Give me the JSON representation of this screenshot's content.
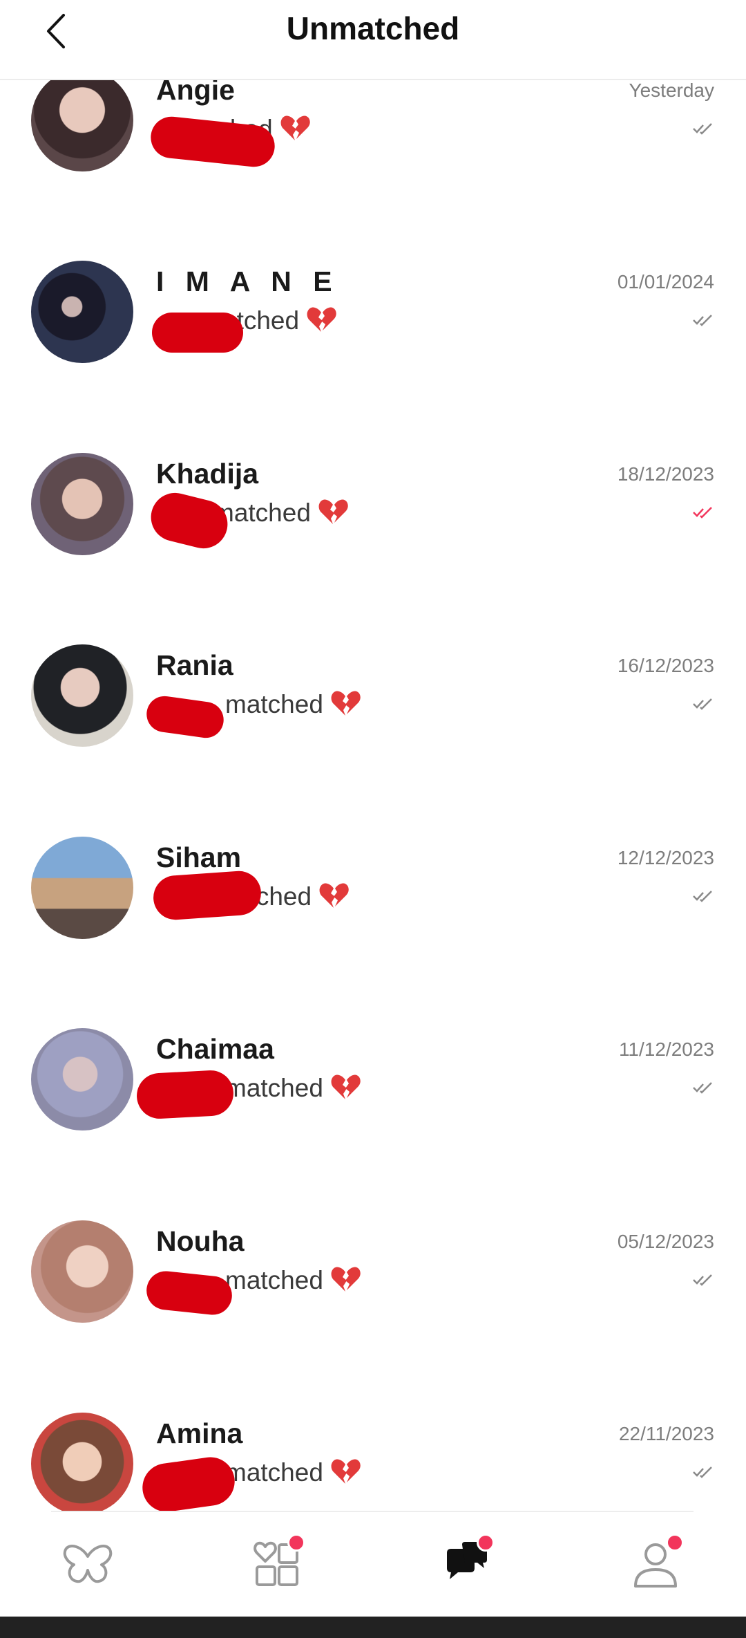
{
  "header": {
    "title": "Unmatched",
    "back_icon": "chevron-left-icon"
  },
  "rows": [
    {
      "name": "Angie",
      "preview": "matched",
      "date": "Yesterday",
      "read": false,
      "avatar_bg": "#4a3a3c"
    },
    {
      "name": "I M A N E",
      "preview": "atched",
      "date": "01/01/2024",
      "read": false,
      "avatar_bg": "#2a2e3e"
    },
    {
      "name": "Khadija",
      "preview": "matched",
      "date": "18/12/2023",
      "read": true,
      "avatar_bg": "#8a6f73"
    },
    {
      "name": "Rania",
      "preview": "matched",
      "date": "16/12/2023",
      "read": false,
      "avatar_bg": "#2b2d33"
    },
    {
      "name": "Siham",
      "preview": "atched",
      "date": "12/12/2023",
      "read": false,
      "avatar_bg": "#7fa4c8"
    },
    {
      "name": "Chaimaa",
      "preview": "matched",
      "date": "11/12/2023",
      "read": false,
      "avatar_bg": "#a2a2b8"
    },
    {
      "name": "Nouha",
      "preview": "matched",
      "date": "05/12/2023",
      "read": false,
      "avatar_bg": "#b6887a"
    },
    {
      "name": "Amina",
      "preview": "matched",
      "date": "22/11/2023",
      "read": false,
      "avatar_bg": "#8b5a47"
    }
  ],
  "status_icons": {
    "broken_heart": "broken-heart-icon",
    "check": "double-check-icon"
  },
  "colors": {
    "accent": "#f2355b",
    "read_check": "#f2355b",
    "unread_check": "#8a8a8a",
    "redaction": "#d8000f"
  },
  "bottom_nav": [
    {
      "icon": "butterfly-icon",
      "badge": false,
      "active": false
    },
    {
      "icon": "heart-grid-icon",
      "badge": true,
      "active": false
    },
    {
      "icon": "chat-icon",
      "badge": true,
      "active": true
    },
    {
      "icon": "profile-icon",
      "badge": true,
      "active": false
    }
  ]
}
